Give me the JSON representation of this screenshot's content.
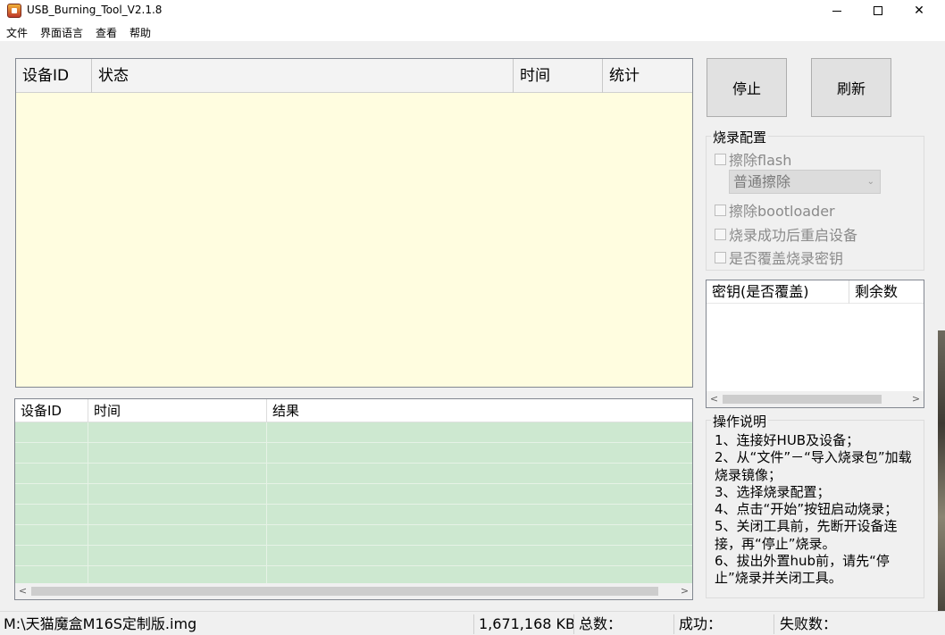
{
  "window": {
    "title": "USB_Burning_Tool_V2.1.8",
    "app_icon": "usb-burning-tool-icon",
    "controls": {
      "minimize": "minimize-icon",
      "maximize": "maximize-icon",
      "close": "close-icon"
    },
    "close_glyph": "✕"
  },
  "menu": {
    "items": [
      "文件",
      "界面语言",
      "查看",
      "帮助"
    ]
  },
  "device_list": {
    "columns": [
      "设备ID",
      "状态",
      "时间",
      "统计"
    ],
    "background": "#fffde0"
  },
  "result_list": {
    "columns": [
      "设备ID",
      "时间",
      "结果"
    ],
    "background": "#cde8d0",
    "scroll_left": "<",
    "scroll_right": ">"
  },
  "buttons": {
    "stop": "停止",
    "refresh": "刷新"
  },
  "burn_config": {
    "title": "烧录配置",
    "erase_flash": "擦除flash",
    "erase_mode": "普通擦除",
    "erase_bootloader": "擦除bootloader",
    "reboot_after_success": "烧录成功后重启设备",
    "overwrite_key": "是否覆盖烧录密钥"
  },
  "key_list": {
    "columns": [
      "密钥(是否覆盖)",
      "剩余数"
    ],
    "scroll_left": "<",
    "scroll_right": ">"
  },
  "instructions": {
    "title": "操作说明",
    "text": "1、连接好HUB及设备；\n2、从“文件”－“导入烧录包”加载烧录镜像；\n3、选择烧录配置；\n4、点击“开始”按钮启动烧录；\n5、关闭工具前，先断开设备连接，再“停止”烧录。\n6、拔出外置hub前，请先“停止”烧录并关闭工具。"
  },
  "status_bar": {
    "image_path": "M:\\天猫魔盒M16S定制版.img",
    "image_size": "1,671,168 KB",
    "total_label": "总数：",
    "success_label": "成功：",
    "fail_label": "失败数："
  }
}
